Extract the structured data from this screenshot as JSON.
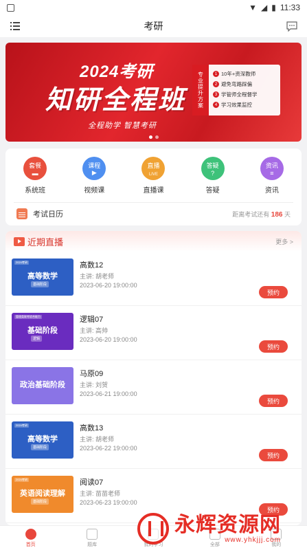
{
  "status_bar": {
    "time": "11:33"
  },
  "app_bar": {
    "title": "考研"
  },
  "banner": {
    "year_title": "2024考研",
    "main_title": "知研全程班",
    "slogan": "全程助学 智慧考研",
    "panel_tag": "专业提升方案",
    "features": [
      "10年+资深教师",
      "避免弯路踩偏",
      "学管师全程督学",
      "学习效果监控"
    ],
    "feature_numbers": [
      "1",
      "2",
      "3",
      "4"
    ]
  },
  "menu": {
    "items": [
      {
        "label": "系统班",
        "tag": "套餐",
        "color": "#e8503d"
      },
      {
        "label": "视频课",
        "tag": "课程",
        "color": "#4f8ff0"
      },
      {
        "label": "直播课",
        "tag": "直播",
        "color": "#f0a233",
        "sub": "LIVE"
      },
      {
        "label": "答疑",
        "tag": "答疑",
        "color": "#3ec27a"
      },
      {
        "label": "资讯",
        "tag": "资讯",
        "color": "#a66ae6"
      }
    ]
  },
  "calendar": {
    "label": "考试日历",
    "countdown_prefix": "距离考试还有",
    "days": "186",
    "unit": "天"
  },
  "live": {
    "section_title": "近期直播",
    "more_label": "更多 >",
    "book_label": "预约",
    "courses": [
      {
        "name": "高数12",
        "teacher": "主讲: 胡老师",
        "time": "2023-06-20 19:00:00",
        "thumb_title": "高等数学",
        "thumb_sub": "基础阶段",
        "thumb_badge": "2024考研",
        "thumb_color": "#2d5fc4"
      },
      {
        "name": "逻辑07",
        "teacher": "主讲: 高帅",
        "time": "2023-06-20 19:00:00",
        "thumb_title": "基础阶段",
        "thumb_sub": "逻辑",
        "thumb_badge": "管理类联考综合能力",
        "thumb_color": "#6a2cbf"
      },
      {
        "name": "马原09",
        "teacher": "主讲: 刘贺",
        "time": "2023-06-21 19:00:00",
        "thumb_title": "政治基础阶段",
        "thumb_sub": "",
        "thumb_badge": "",
        "thumb_color": "#8a74e6"
      },
      {
        "name": "高数13",
        "teacher": "主讲: 胡老师",
        "time": "2023-06-22 19:00:00",
        "thumb_title": "高等数学",
        "thumb_sub": "基础阶段",
        "thumb_badge": "2024考研",
        "thumb_color": "#2d5fc4"
      },
      {
        "name": "阅读07",
        "teacher": "主讲: 苗苗老师",
        "time": "2023-06-23 19:00:00",
        "thumb_title": "英语阅读理解",
        "thumb_sub": "基础阶段",
        "thumb_badge": "2024考研",
        "thumb_color": "#f08a2c"
      }
    ]
  },
  "tabbar": {
    "items": [
      {
        "label": "首页",
        "active": true
      },
      {
        "label": "题库"
      },
      {
        "label": "我的学习"
      },
      {
        "label": "全部"
      },
      {
        "label": "我的"
      }
    ]
  },
  "watermark": {
    "brand": "永辉资源网",
    "url": "www.yhkjjj.com"
  }
}
